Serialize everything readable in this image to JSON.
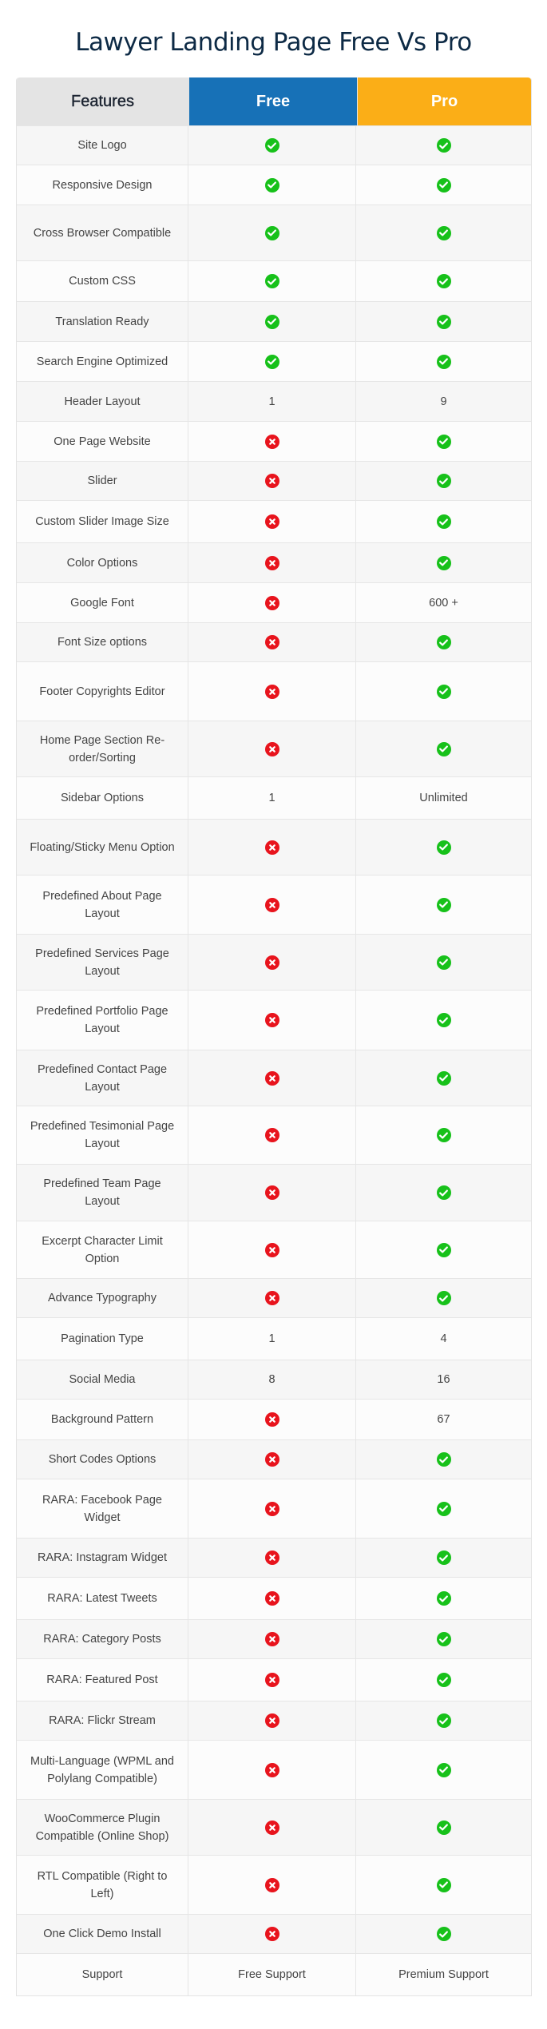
{
  "title": "Lawyer Landing Page Free Vs Pro",
  "colors": {
    "free_header": "#1771b7",
    "pro_header": "#fbae17",
    "features_header": "#e4e4e4",
    "check": "#17c11a",
    "cross": "#e8141d"
  },
  "header": {
    "features": "Features",
    "free": "Free",
    "pro": "Pro"
  },
  "rows": [
    {
      "feature": "Site Logo",
      "free": "check-icon",
      "pro": "check-icon",
      "h": 49
    },
    {
      "feature": "Responsive Design",
      "free": "check-icon",
      "pro": "check-icon",
      "h": 50
    },
    {
      "feature": "Cross Browser Compatible",
      "free": "check-icon",
      "pro": "check-icon",
      "h": 70
    },
    {
      "feature": "Custom CSS",
      "free": "check-icon",
      "pro": "check-icon",
      "h": 51
    },
    {
      "feature": "Translation Ready",
      "free": "check-icon",
      "pro": "check-icon",
      "h": 50
    },
    {
      "feature": "Search Engine Optimized",
      "free": "check-icon",
      "pro": "check-icon",
      "h": 50
    },
    {
      "feature": "Header Layout",
      "free": "1",
      "pro": "9",
      "h": 50
    },
    {
      "feature": "One Page Website",
      "free": "cross-icon",
      "pro": "check-icon",
      "h": 50
    },
    {
      "feature": "Slider",
      "free": "cross-icon",
      "pro": "check-icon",
      "h": 49
    },
    {
      "feature": "Custom Slider Image Size",
      "free": "cross-icon",
      "pro": "check-icon",
      "h": 53
    },
    {
      "feature": "Color Options",
      "free": "cross-icon",
      "pro": "check-icon",
      "h": 50
    },
    {
      "feature": "Google Font",
      "free": "cross-icon",
      "pro": "600 +",
      "h": 50
    },
    {
      "feature": "Font Size options",
      "free": "cross-icon",
      "pro": "check-icon",
      "h": 49
    },
    {
      "feature": "Footer Copyrights Editor",
      "free": "cross-icon",
      "pro": "check-icon",
      "h": 74
    },
    {
      "feature": "Home Page Section Re-order/Sorting",
      "free": "cross-icon",
      "pro": "check-icon",
      "h": 70
    },
    {
      "feature": "Sidebar Options",
      "free": "1",
      "pro": "Unlimited",
      "h": 53
    },
    {
      "feature": "Floating/Sticky Menu Option",
      "free": "cross-icon",
      "pro": "check-icon",
      "h": 70
    },
    {
      "feature": "Predefined About Page Layout",
      "free": "cross-icon",
      "pro": "check-icon",
      "h": 74
    },
    {
      "feature": "Predefined Services Page Layout",
      "free": "cross-icon",
      "pro": "check-icon",
      "h": 70
    },
    {
      "feature": "Predefined Portfolio Page Layout",
      "free": "cross-icon",
      "pro": "check-icon",
      "h": 75
    },
    {
      "feature": "Predefined Contact Page Layout",
      "free": "cross-icon",
      "pro": "check-icon",
      "h": 70
    },
    {
      "feature": "Predefined Tesimonial Page Layout",
      "free": "cross-icon",
      "pro": "check-icon",
      "h": 73
    },
    {
      "feature": "Predefined Team Page Layout",
      "free": "cross-icon",
      "pro": "check-icon",
      "h": 71
    },
    {
      "feature": "Excerpt Character Limit Option",
      "free": "cross-icon",
      "pro": "check-icon",
      "h": 72
    },
    {
      "feature": "Advance Typography",
      "free": "cross-icon",
      "pro": "check-icon",
      "h": 49
    },
    {
      "feature": "Pagination Type",
      "free": "1",
      "pro": "4",
      "h": 53
    },
    {
      "feature": "Social Media",
      "free": "8",
      "pro": "16",
      "h": 49
    },
    {
      "feature": "Background Pattern",
      "free": "cross-icon",
      "pro": "67",
      "h": 51
    },
    {
      "feature": "Short Codes Options",
      "free": "cross-icon",
      "pro": "check-icon",
      "h": 49
    },
    {
      "feature": "RARA: Facebook Page Widget",
      "free": "cross-icon",
      "pro": "check-icon",
      "h": 74
    },
    {
      "feature": "RARA: Instagram Widget",
      "free": "cross-icon",
      "pro": "check-icon",
      "h": 49
    },
    {
      "feature": "RARA: Latest Tweets",
      "free": "cross-icon",
      "pro": "check-icon",
      "h": 53
    },
    {
      "feature": "RARA: Category Posts",
      "free": "cross-icon",
      "pro": "check-icon",
      "h": 49
    },
    {
      "feature": "RARA: Featured Post",
      "free": "cross-icon",
      "pro": "check-icon",
      "h": 53
    },
    {
      "feature": "RARA: Flickr Stream",
      "free": "cross-icon",
      "pro": "check-icon",
      "h": 49
    },
    {
      "feature": "Multi-Language (WPML and Polylang Compatible)",
      "free": "cross-icon",
      "pro": "check-icon",
      "h": 74
    },
    {
      "feature": "WooCommerce Plugin Compatible (Online Shop)",
      "free": "cross-icon",
      "pro": "check-icon",
      "h": 70
    },
    {
      "feature": "RTL Compatible (Right to Left)",
      "free": "cross-icon",
      "pro": "check-icon",
      "h": 74
    },
    {
      "feature": "One Click Demo Install",
      "free": "cross-icon",
      "pro": "check-icon",
      "h": 49
    },
    {
      "feature": "Support",
      "free": "Free Support",
      "pro": "Premium Support",
      "h": 53
    }
  ]
}
